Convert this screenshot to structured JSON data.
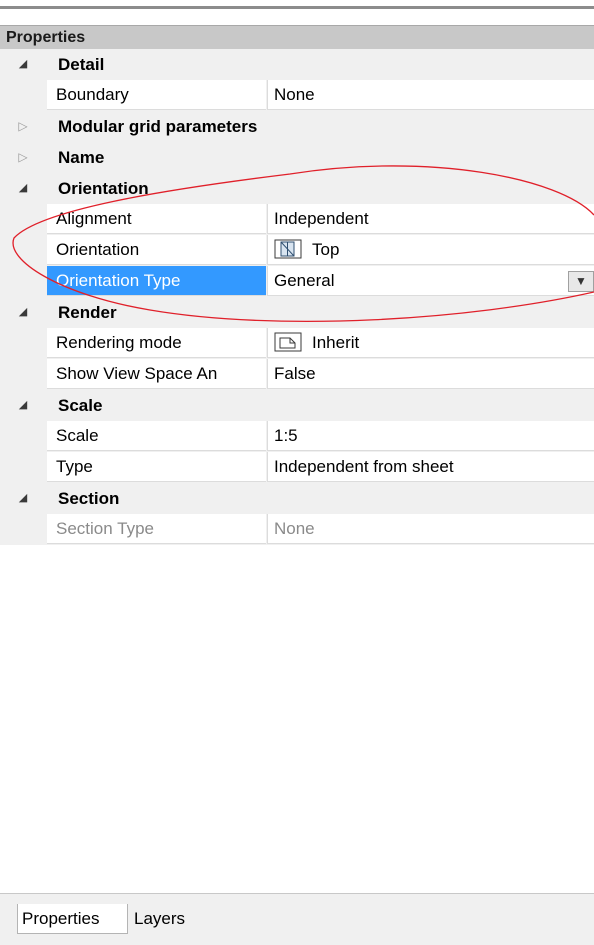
{
  "panel": {
    "title": "Properties"
  },
  "categories": {
    "detail": {
      "label": "Detail",
      "boundary": {
        "name": "Boundary",
        "value": "None"
      }
    },
    "modular": {
      "label": "Modular grid parameters"
    },
    "name": {
      "label": "Name"
    },
    "orientation": {
      "label": "Orientation",
      "alignment": {
        "name": "Alignment",
        "value": "Independent"
      },
      "orientation": {
        "name": "Orientation",
        "value": "Top",
        "icon": "view-cube-icon"
      },
      "orientation_type": {
        "name": "Orientation Type",
        "value": "General"
      }
    },
    "render": {
      "label": "Render",
      "rendering_mode": {
        "name": "Rendering mode",
        "value": "Inherit",
        "icon": "render-page-icon"
      },
      "show_view_space": {
        "name": "Show View Space An",
        "value": "False"
      }
    },
    "scale": {
      "label": "Scale",
      "scale": {
        "name": "Scale",
        "value": "1:5"
      },
      "type": {
        "name": "Type",
        "value": "Independent from sheet"
      }
    },
    "section": {
      "label": "Section",
      "section_type": {
        "name": "Section Type",
        "value": "None"
      }
    }
  },
  "tabs": [
    "Properties",
    "Layers"
  ],
  "colors": {
    "selection": "#3399ff",
    "annotation": "#e0202a",
    "header": "#c8c8c8"
  }
}
